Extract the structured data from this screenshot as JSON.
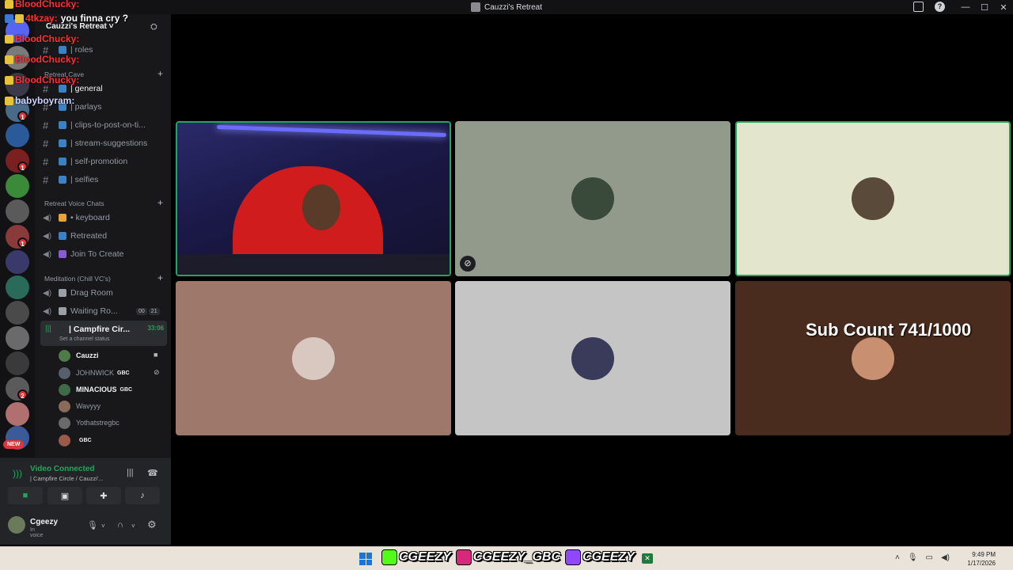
{
  "window": {
    "title": "Cauzzi's Retreat"
  },
  "server": {
    "name": "Cauzzi's Retreat ˅"
  },
  "channels": {
    "top": [
      {
        "label": "| roles"
      }
    ],
    "category1": "Retreat Cave",
    "cave": [
      {
        "label": "| general"
      },
      {
        "label": "| parlays"
      },
      {
        "label": "| clips-to-post-on-ti..."
      },
      {
        "label": "| stream-suggestions"
      },
      {
        "label": "| self-promotion"
      },
      {
        "label": "| selfies"
      }
    ],
    "category2": "Retreat Voice Chats",
    "voice": [
      {
        "label": "• keyboard"
      },
      {
        "label": "Retreated"
      },
      {
        "label": "Join To Create"
      }
    ],
    "category3": "Meditation (Chill VC's)",
    "meditation": [
      {
        "label": "Drag Room"
      },
      {
        "label": "Waiting Ro..."
      }
    ],
    "waiting_counts": [
      "00",
      "21"
    ],
    "active": {
      "label": "| Campfire Cir...",
      "time": "33:06",
      "status": "Set a channel status"
    },
    "members": [
      {
        "name": "Cauzzi",
        "tag": "",
        "color": "#4f7a4a"
      },
      {
        "name": "JOHNWICK",
        "tag": "GBC",
        "color": "#56606a"
      },
      {
        "name": "MINACIOUS",
        "tag": "GBC",
        "color": "#3f6a4a"
      },
      {
        "name": "Wavyyy",
        "tag": "",
        "color": "#8a6a5a"
      },
      {
        "name": "Yothatstregbc",
        "tag": "",
        "color": "#6a6a6a"
      },
      {
        "name": "",
        "tag": "GBC",
        "color": "#9a5a4a"
      }
    ]
  },
  "voice_panel": {
    "title": "Video Connected",
    "subtitle": "| Campfire Circle / Cauzzi'..."
  },
  "user": {
    "name": "Cgeezy",
    "status": "In voice"
  },
  "chat_overlay": [
    {
      "name": "BloodChucky:",
      "msg": "",
      "color": "#ff3030"
    },
    {
      "name": "4tkzay:",
      "msg": "you finna cry ?",
      "color": "#ff3030"
    },
    {
      "name": "BloodChucky:",
      "msg": "",
      "color": "#ff3030"
    },
    {
      "name": "BloodChucky:",
      "msg": "",
      "color": "#ff3030"
    },
    {
      "name": "BloodChucky:",
      "msg": "",
      "color": "#ff3030"
    },
    {
      "name": "babyboyram:",
      "msg": "",
      "color": "#cfd4ff"
    }
  ],
  "rail": {
    "new_label": "NEW",
    "badges": [
      "1",
      "1",
      "1",
      "2"
    ]
  },
  "video": {
    "overlay": "Sub Count 741/1000"
  },
  "taskbar": {
    "handles": [
      "CGEEZY",
      "CGEEZY_GBC",
      "CGEEZY"
    ],
    "time": "9:49 PM",
    "date": "1/17/2026"
  },
  "colors": {
    "accent_green": "#23a55a",
    "danger": "#da373c"
  }
}
